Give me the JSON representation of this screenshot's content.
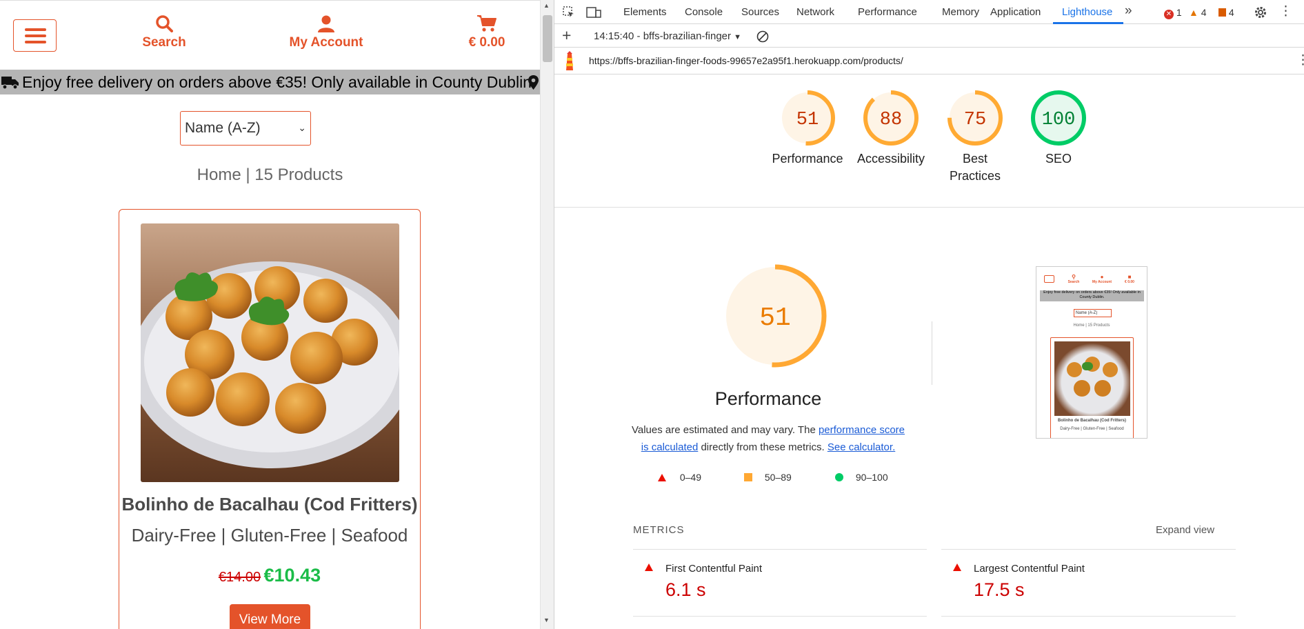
{
  "site": {
    "nav": {
      "search_label": "Search",
      "account_label": "My Account",
      "cart_label": "€ 0.00"
    },
    "banner": "Enjoy free delivery on orders above €35! Only available in County Dublin.",
    "sort": {
      "selected": "Name (A-Z)"
    },
    "breadcrumb": "Home | 15 Products",
    "product": {
      "name": "Bolinho de Bacalhau (Cod Fritters)",
      "tags": "Dairy-Free | Gluten-Free | Seafood",
      "old_price": "€14.00",
      "new_price": "€10.43",
      "button": "View More"
    }
  },
  "devtools": {
    "tabs": [
      "Elements",
      "Console",
      "Sources",
      "Network",
      "Performance",
      "Memory",
      "Application",
      "Lighthouse"
    ],
    "active_tab": "Lighthouse",
    "badges": {
      "errors": "1",
      "warnings": "4",
      "issues": "4"
    },
    "report_select": "14:15:40 - bffs-brazilian-finger",
    "url": "https://bffs-brazilian-finger-foods-99657e2a95f1.herokuapp.com/products/",
    "scores": [
      {
        "label": "Performance",
        "value": 51,
        "color": "#fa3"
      },
      {
        "label": "Accessibility",
        "value": 88,
        "color": "#fa3"
      },
      {
        "label": "Best Practices",
        "value": 75,
        "color": "#fa3"
      },
      {
        "label": "SEO",
        "value": 100,
        "color": "#0c6"
      }
    ],
    "main_score": {
      "label": "Performance",
      "value": 51
    },
    "description": {
      "prefix": "Values are estimated and may vary. The ",
      "link1": "performance score is calculated",
      "middle": " directly from these metrics. ",
      "link2": "See calculator."
    },
    "legend": {
      "red": "0–49",
      "orange": "50–89",
      "green": "90–100"
    },
    "metrics_heading": "METRICS",
    "expand_label": "Expand view",
    "metrics": [
      {
        "name": "First Contentful Paint",
        "value": "6.1 s"
      },
      {
        "name": "Largest Contentful Paint",
        "value": "17.5 s"
      }
    ],
    "thumbnail": {
      "nav": [
        "Search",
        "My Account",
        "€ 0.00"
      ],
      "banner": "Enjoy free delivery on orders above €35! Only available in County Dublin.",
      "sort": "Name (A-Z)",
      "crumb": "Home | 15 Products",
      "title": "Bolinho de Bacalhau (Cod Fritters)",
      "tags": "Dairy-Free | Gluten-Free | Seafood"
    }
  },
  "colors": {
    "accent": "#e4532a",
    "sale_green": "#1bbc48",
    "fail_red": "#cc0000",
    "average_orange": "#ffaa33",
    "pass_green": "#00cc66"
  }
}
